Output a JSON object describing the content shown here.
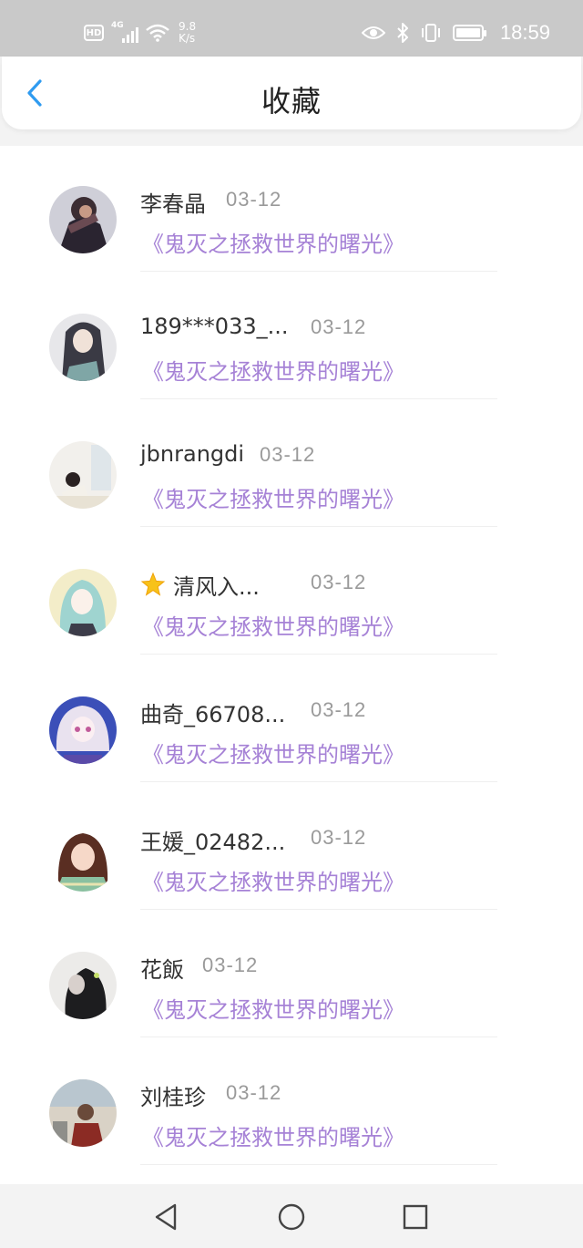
{
  "status_bar": {
    "network_badge": "HD",
    "signal_tag": "4G",
    "speed_value": "9.8",
    "speed_unit": "K/s",
    "time": "18:59"
  },
  "header": {
    "title": "收藏"
  },
  "favorites": [
    {
      "name": "李春晶",
      "date": "03-12",
      "work": "《鬼灭之拯救世界的曙光》"
    },
    {
      "name": "189***033_...",
      "date": "03-12",
      "work": "《鬼灭之拯救世界的曙光》"
    },
    {
      "name": "jbnrangdi",
      "date": "03-12",
      "work": "《鬼灭之拯救世界的曙光》"
    },
    {
      "name": "清风入...",
      "date": "03-12",
      "work": "《鬼灭之拯救世界的曙光》"
    },
    {
      "name": "曲奇_66708...",
      "date": "03-12",
      "work": "《鬼灭之拯救世界的曙光》"
    },
    {
      "name": "王媛_02482...",
      "date": "03-12",
      "work": "《鬼灭之拯救世界的曙光》"
    },
    {
      "name": "花飯",
      "date": "03-12",
      "work": "《鬼灭之拯救世界的曙光》"
    },
    {
      "name": "刘桂珍",
      "date": "03-12",
      "work": "《鬼灭之拯救世界的曙光》"
    }
  ],
  "icons": {
    "back": "chevron-left-icon",
    "name_prefix_row4": "star-icon",
    "nav_back": "triangle-back-icon",
    "nav_home": "circle-home-icon",
    "nav_recents": "square-recents-icon"
  },
  "colors": {
    "accent_blue": "#2f9bf0",
    "link_purple": "#a682d6",
    "date_gray": "#9a9a9a",
    "status_bar_bg": "#c9c9c9"
  }
}
